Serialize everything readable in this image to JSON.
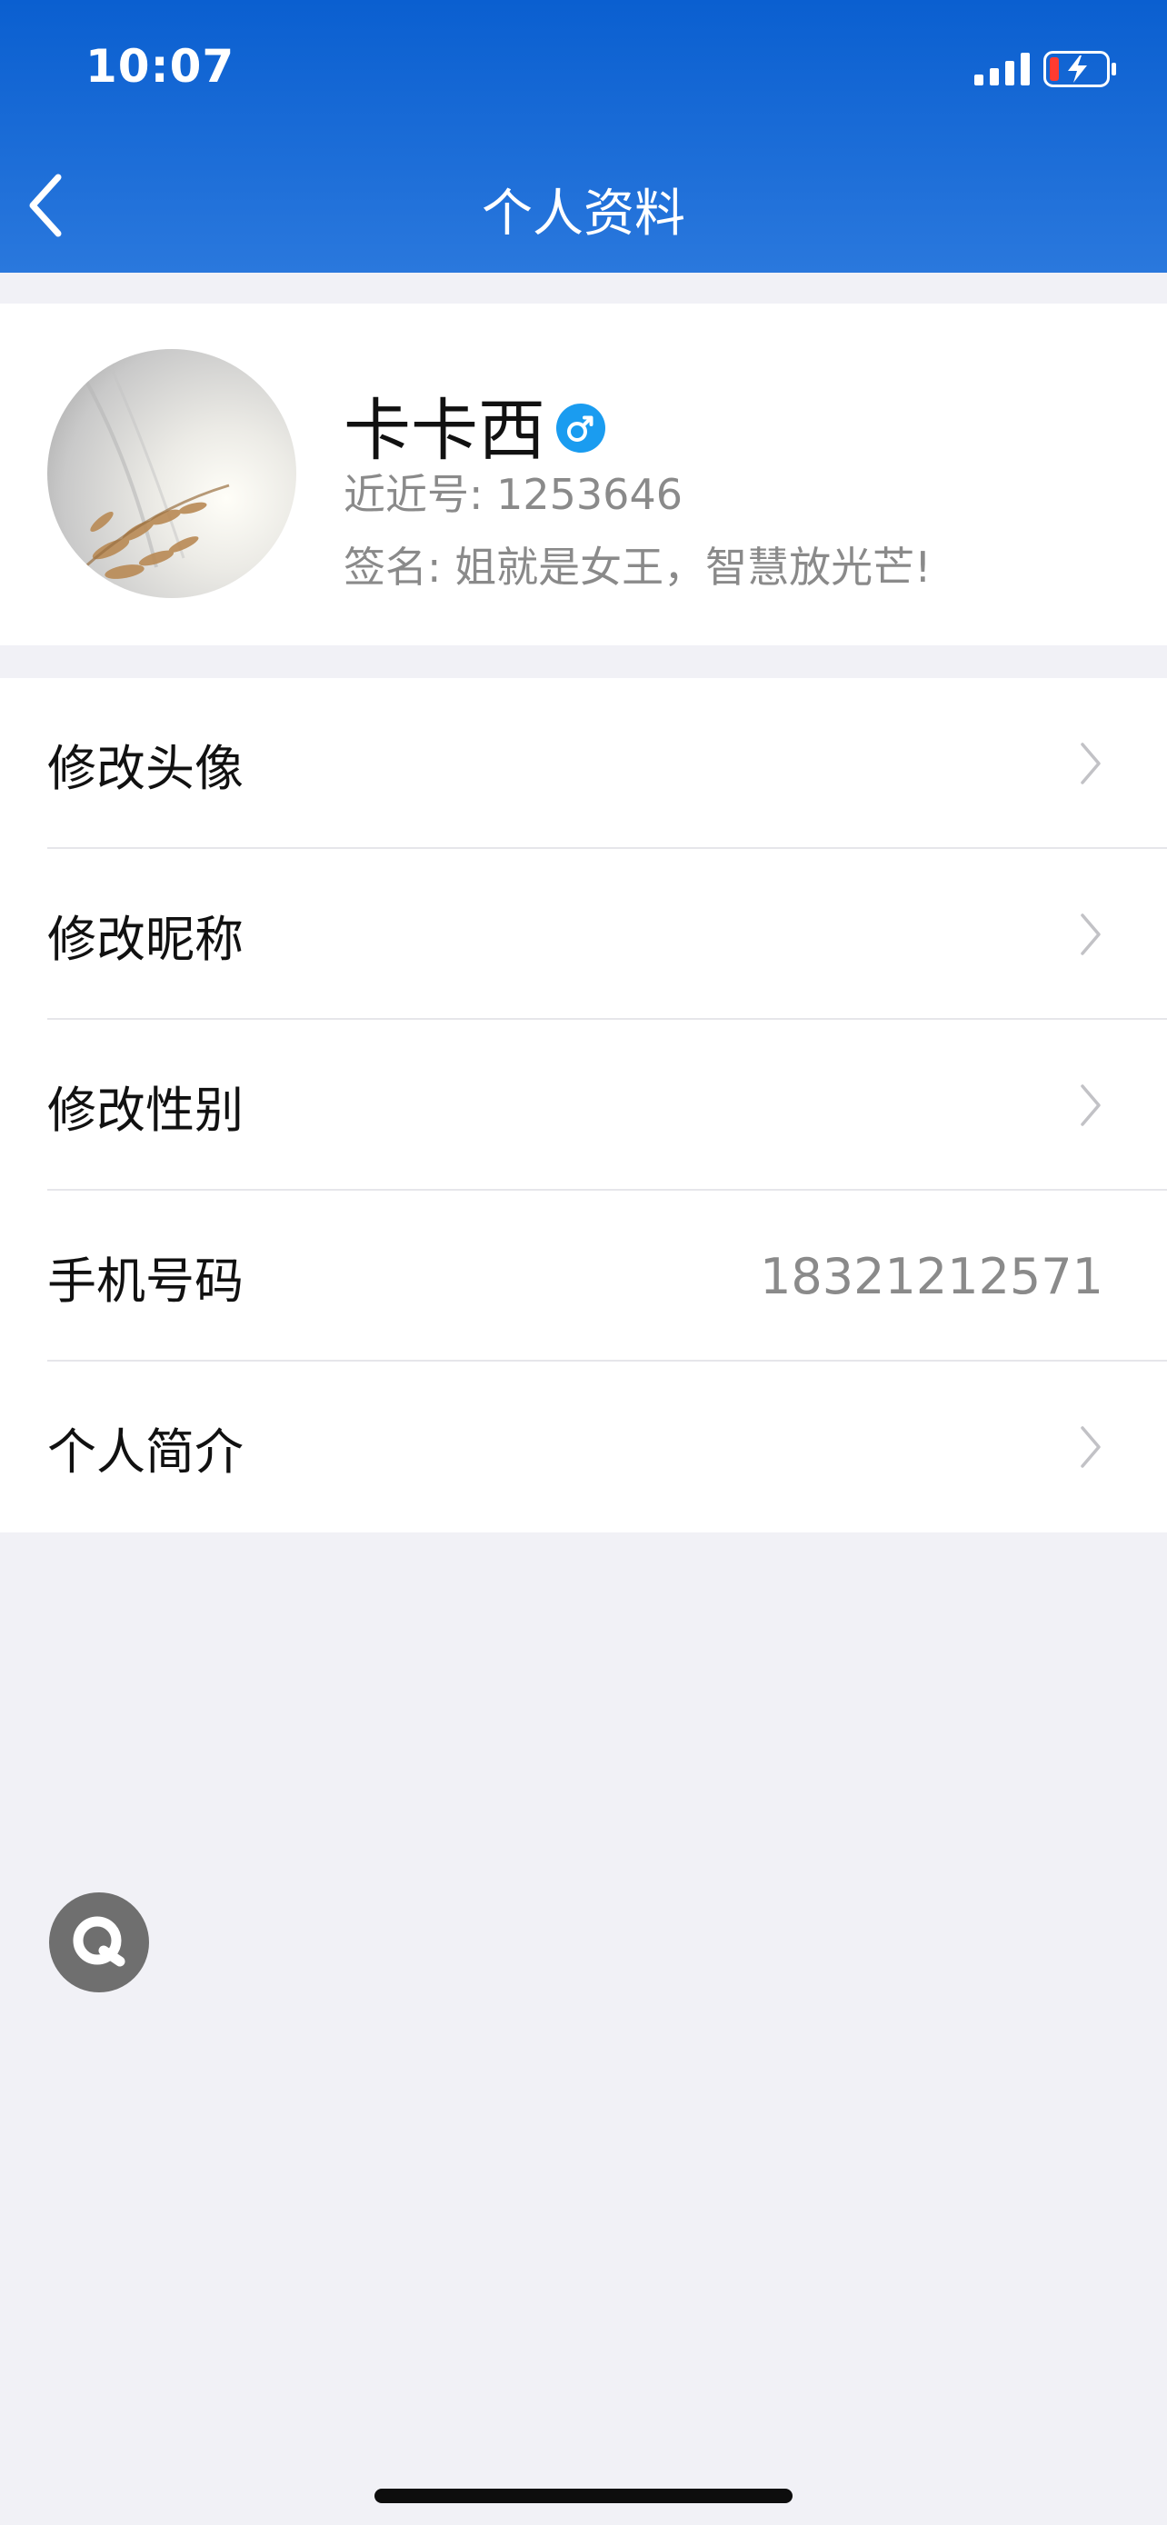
{
  "status_bar": {
    "time": "10:07",
    "signal_icon": "cellular-signal-icon",
    "battery_icon": "battery-charging-low-icon"
  },
  "nav": {
    "back_icon": "chevron-left-icon",
    "title": "个人资料"
  },
  "profile": {
    "name": "卡卡西",
    "gender_icon": "male-icon",
    "id_line": "近近号: 1253646",
    "signature_line": "签名: 姐就是女王，智慧放光芒!"
  },
  "menu": {
    "items": [
      {
        "label": "修改头像",
        "value": "",
        "has_chevron": true
      },
      {
        "label": "修改昵称",
        "value": "",
        "has_chevron": true
      },
      {
        "label": "修改性别",
        "value": "",
        "has_chevron": true
      },
      {
        "label": "手机号码",
        "value": "18321212571",
        "has_chevron": false
      },
      {
        "label": "个人简介",
        "value": "",
        "has_chevron": true
      }
    ]
  },
  "colors": {
    "header_top": "#0a5fd0",
    "header_bottom": "#2a78dd",
    "background": "#f1f1f6",
    "gender_blue": "#1a9cf0",
    "secondary_text": "#8a8a8a"
  }
}
